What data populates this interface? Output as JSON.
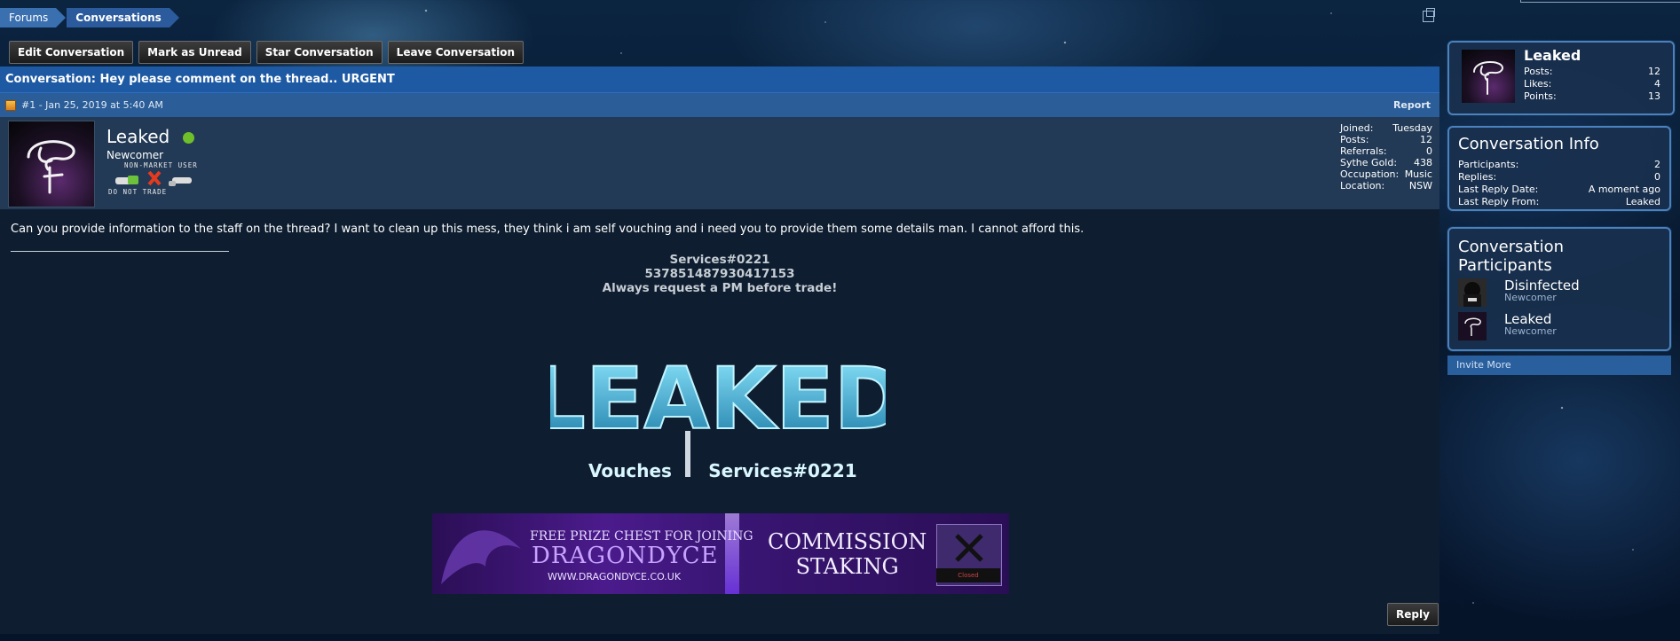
{
  "breadcrumb": {
    "forums": "Forums",
    "conversations": "Conversations"
  },
  "actions": {
    "edit": "Edit Conversation",
    "mark_unread": "Mark as Unread",
    "star": "Star Conversation",
    "leave": "Leave Conversation"
  },
  "conversation": {
    "title": "Conversation: Hey please comment on the thread.. URGENT"
  },
  "message": {
    "meta": "#1 - Jan 25, 2019 at 5:40 AM",
    "report": "Report",
    "author": {
      "name": "Leaked",
      "title": "Newcomer",
      "badge_top": "NON-MARKET USER",
      "badge_bottom": "DO NOT TRADE",
      "online": true
    },
    "stats": [
      {
        "label": "Joined:",
        "value": "Tuesday"
      },
      {
        "label": "Posts:",
        "value": "12"
      },
      {
        "label": "Referrals:",
        "value": "0"
      },
      {
        "label": "Sythe Gold:",
        "value": "438"
      },
      {
        "label": "Occupation:",
        "value": "Music"
      },
      {
        "label": "Location:",
        "value": "NSW"
      }
    ],
    "body": "Can you provide information to the staff on the thread? I want to clean up this mess, they think i am self vouching and i need you to provide them some details man. I cannot afford this.",
    "signature": {
      "line1": "Services#0221",
      "line2": "537851487930417153",
      "line3": "Always request a PM before trade!",
      "logo_text": "LEAKED",
      "logo_left": "Vouches",
      "logo_right": "Services#0221"
    },
    "banner": {
      "free": "FREE PRIZE CHEST FOR JOINING",
      "brand": "DRAGONDYCE",
      "url": "WWW.DRAGONDYCE.CO.UK",
      "right_line1": "COMMISSION",
      "right_line2": "STAKING",
      "closed": "Closed"
    },
    "reply": "Reply"
  },
  "sidebar": {
    "profile": {
      "name": "Leaked",
      "posts_label": "Posts:",
      "posts": "12",
      "likes_label": "Likes:",
      "likes": "4",
      "points_label": "Points:",
      "points": "13"
    },
    "info": {
      "heading": "Conversation Info",
      "rows": [
        {
          "label": "Participants:",
          "value": "2"
        },
        {
          "label": "Replies:",
          "value": "0"
        },
        {
          "label": "Last Reply Date:",
          "value": "A moment ago"
        },
        {
          "label": "Last Reply From:",
          "value": "Leaked"
        }
      ]
    },
    "participants": {
      "heading": "Conversation Participants",
      "list": [
        {
          "name": "Disinfected",
          "title": "Newcomer"
        },
        {
          "name": "Leaked",
          "title": "Newcomer"
        }
      ]
    },
    "invite": "Invite More"
  },
  "colors": {
    "title_bar": "#1e5aa3",
    "online": "#6fbf2a",
    "accent": "#4a82bf"
  }
}
